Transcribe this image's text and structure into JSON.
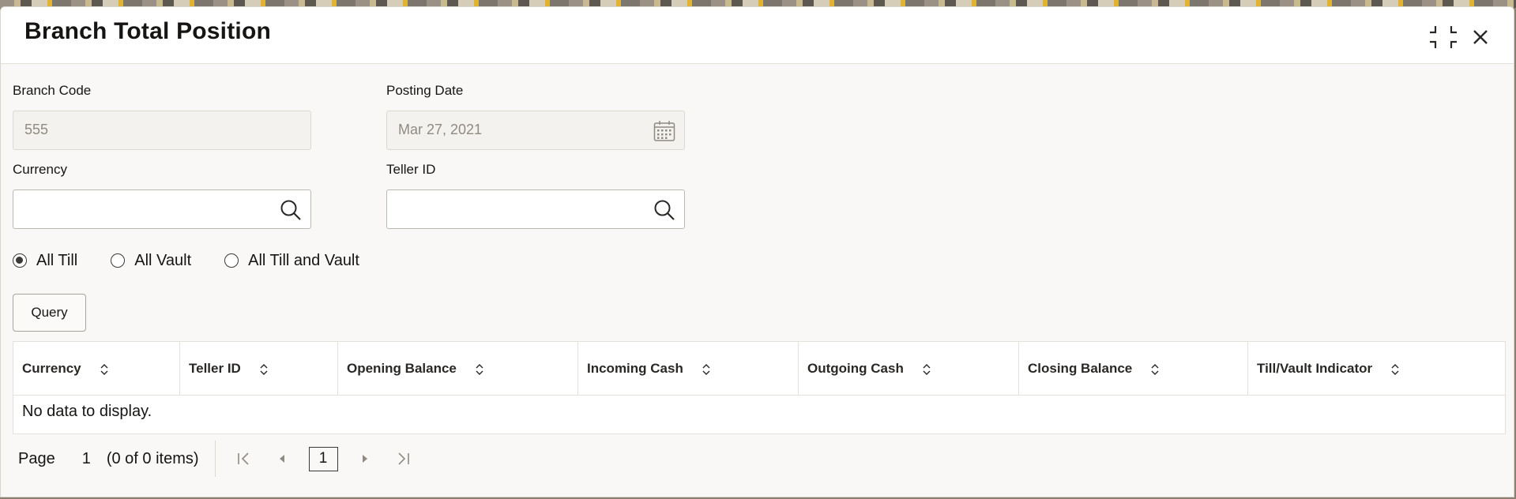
{
  "dialog": {
    "title": "Branch Total Position"
  },
  "form": {
    "branch_code": {
      "label": "Branch Code",
      "value": "555"
    },
    "posting_date": {
      "label": "Posting Date",
      "value": "Mar 27, 2021"
    },
    "currency": {
      "label": "Currency",
      "value": ""
    },
    "teller_id": {
      "label": "Teller ID",
      "value": ""
    }
  },
  "options": [
    {
      "label": "All Till",
      "selected": true
    },
    {
      "label": "All Vault",
      "selected": false
    },
    {
      "label": "All Till and Vault",
      "selected": false
    }
  ],
  "query_button": {
    "label": "Query"
  },
  "table": {
    "columns": [
      "Currency",
      "Teller ID",
      "Opening Balance",
      "Incoming Cash",
      "Outgoing Cash",
      "Closing Balance",
      "Till/Vault Indicator"
    ],
    "empty_text": "No data to display."
  },
  "pagination": {
    "page_label": "Page",
    "page_number": "1",
    "items_text": "(0 of 0 items)",
    "current_page": "1"
  },
  "icons": {
    "compress": "compress-icon",
    "close": "close-icon",
    "calendar": "calendar-icon",
    "search": "search-icon",
    "sort": "sort-icon",
    "first": "first-page-icon",
    "previous": "previous-page-icon",
    "next": "next-page-icon",
    "last": "last-page-icon"
  }
}
